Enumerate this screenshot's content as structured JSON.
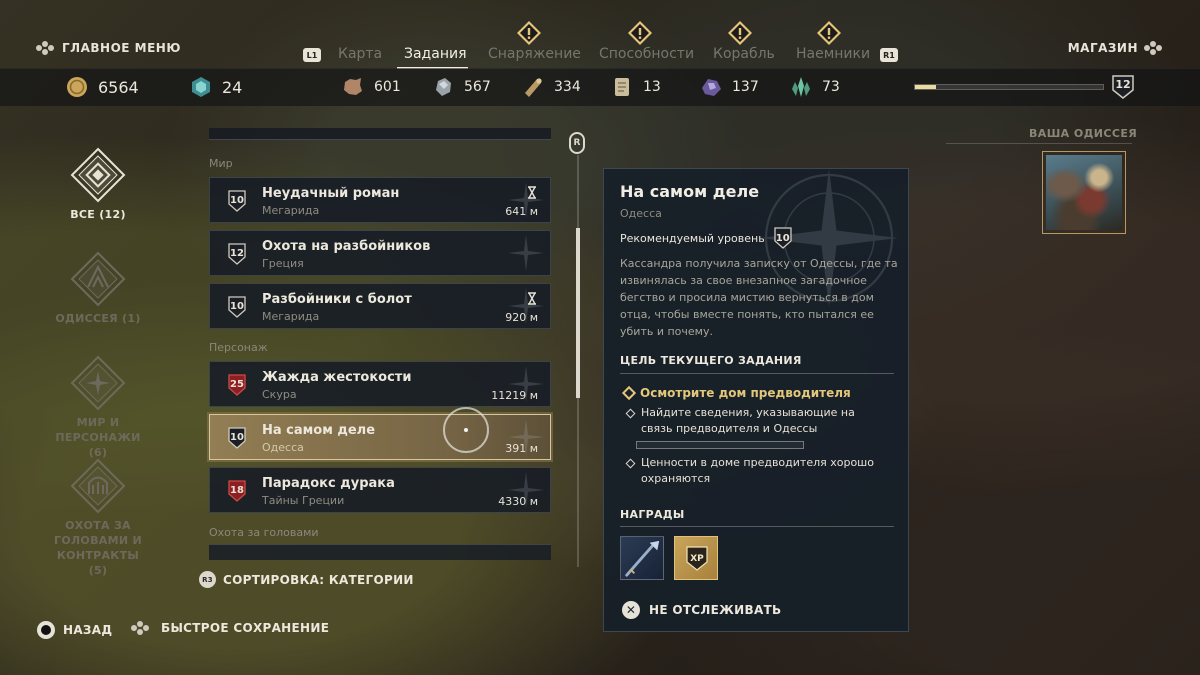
{
  "header": {
    "main_menu_label": "ГЛАВНОЕ МЕНЮ",
    "shop_label": "МАГАЗИН",
    "bumper_left": "L1",
    "bumper_right": "R1",
    "tabs": [
      {
        "label": "Карта",
        "active": false,
        "alert": false
      },
      {
        "label": "Задания",
        "active": true,
        "alert": false
      },
      {
        "label": "Снаряжение",
        "active": false,
        "alert": true
      },
      {
        "label": "Способности",
        "active": false,
        "alert": true
      },
      {
        "label": "Корабль",
        "active": false,
        "alert": true
      },
      {
        "label": "Наемники",
        "active": false,
        "alert": true
      }
    ]
  },
  "resources": {
    "drachmae": "6564",
    "orichalcum": "24",
    "leather": "601",
    "iron": "567",
    "wood": "334",
    "ancient_tablets": "13",
    "obsidian": "137",
    "crystals": "73",
    "level": "12",
    "xp_progress": 0.11
  },
  "categories": [
    {
      "label": "ВСЕ (12)",
      "icon": "all-quests-icon",
      "active": true
    },
    {
      "label": "ОДИССЕЯ (1)",
      "icon": "odyssey-icon",
      "active": false
    },
    {
      "label": "МИР И ПЕРСОНАЖИ (6)",
      "icon": "world-characters-icon",
      "active": false
    },
    {
      "label": "ОХОТА ЗА ГОЛОВАМИ И КОНТРАКТЫ (5)",
      "icon": "bounty-contracts-icon",
      "active": false
    }
  ],
  "quest_list": {
    "sections": {
      "world": "Мир",
      "character": "Персонаж",
      "bounty": "Охота за головами"
    },
    "quests": [
      {
        "level": "10",
        "title": "Неудачный роман",
        "region": "Мегарида",
        "distance": "641 м",
        "timed": true,
        "danger": false,
        "selected": false
      },
      {
        "level": "12",
        "title": "Охота на разбойников",
        "region": "Греция",
        "distance": "",
        "timed": false,
        "danger": false,
        "selected": false
      },
      {
        "level": "10",
        "title": "Разбойники с болот",
        "region": "Мегарида",
        "distance": "920 м",
        "timed": true,
        "danger": false,
        "selected": false
      },
      {
        "level": "25",
        "title": "Жажда жестокости",
        "region": "Скура",
        "distance": "11219 м",
        "timed": false,
        "danger": true,
        "selected": false
      },
      {
        "level": "10",
        "title": "На самом деле",
        "region": "Одесса",
        "distance": "391 м",
        "timed": false,
        "danger": false,
        "selected": true
      },
      {
        "level": "18",
        "title": "Парадокс дурака",
        "region": "Тайны Греции",
        "distance": "4330 м",
        "timed": false,
        "danger": true,
        "selected": false
      }
    ],
    "scroll_button": "R",
    "sort_button": "R3",
    "sort_label": "СОРТИРОВКА: КАТЕГОРИИ"
  },
  "detail": {
    "title": "На самом деле",
    "region": "Одесса",
    "recommended_label": "Рекомендуемый уровень",
    "recommended_level": "10",
    "description": "Кассандра получила записку от Одессы, где та извинялась за свое внезапное загадочное бегство и просила мистию вернуться в дом отца, чтобы вместе понять, кто пытался ее убить и почему.",
    "objective_header": "ЦЕЛЬ ТЕКУЩЕГО ЗАДАНИЯ",
    "main_objective": "Осмотрите дом предводителя",
    "sub_objectives": [
      "Найдите сведения, указывающие на связь предводителя и Одессы",
      "Ценности в доме предводителя хорошо охраняются"
    ],
    "sub_objective_progress": 0.0,
    "rewards_header": "НАГРАДЫ",
    "rewards": [
      {
        "icon": "spear-weapon-icon"
      },
      {
        "icon": "xp-reward-icon",
        "label": "XP"
      }
    ],
    "untrack_label": "НЕ ОТСЛЕЖИВАТЬ"
  },
  "odyssey": {
    "title": "ВАША ОДИССЕЯ"
  },
  "footer": {
    "back_label": "НАЗАД",
    "quicksave_label": "БЫСТРОЕ СОХРАНЕНИЕ"
  },
  "colors": {
    "accent_gold": "#e3c77a",
    "danger_red": "#8e1e22",
    "panel_bg": "#161f28"
  }
}
